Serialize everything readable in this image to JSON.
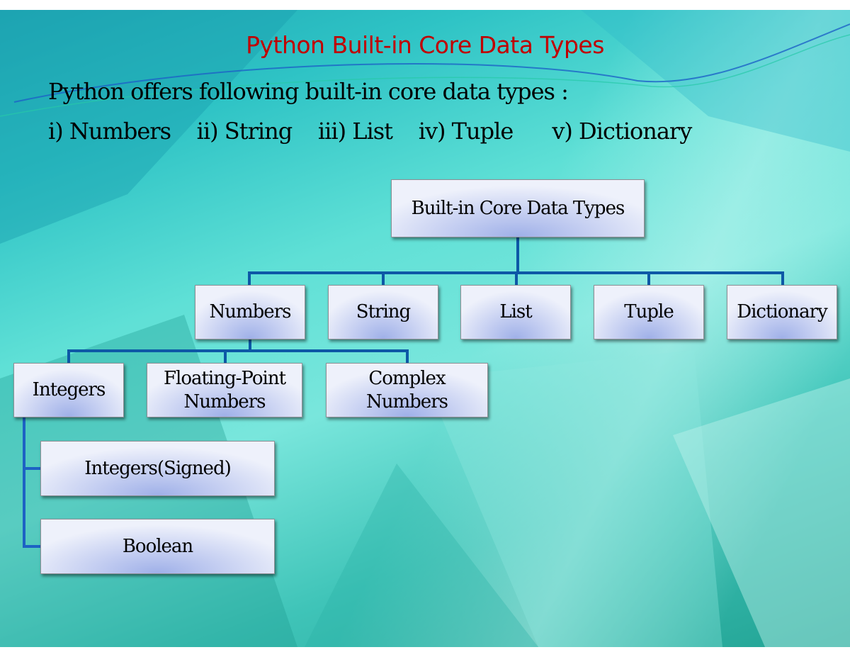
{
  "slide": {
    "title": "Python Built-in Core Data Types",
    "intro": "Python offers following built-in core data types :",
    "enumeration": "i) Numbers    ii) String    iii) List    iv) Tuple      v) Dictionary",
    "colors": {
      "title": "#c00000",
      "connector": "#0d58a6",
      "background": "#5fe0d6"
    }
  },
  "diagram": {
    "root": "Built-in Core Data Types",
    "level1": [
      "Numbers",
      "String",
      "List",
      "Tuple",
      "Dictionary"
    ],
    "numbers_children": [
      "Integers",
      "Floating-Point Numbers",
      "Complex Numbers"
    ],
    "numbers_children_lines": [
      [
        "Integers"
      ],
      [
        "Floating-Point",
        "Numbers"
      ],
      [
        "Complex",
        "Numbers"
      ]
    ],
    "integers_children": [
      "Integers(Signed)",
      "Boolean"
    ]
  }
}
